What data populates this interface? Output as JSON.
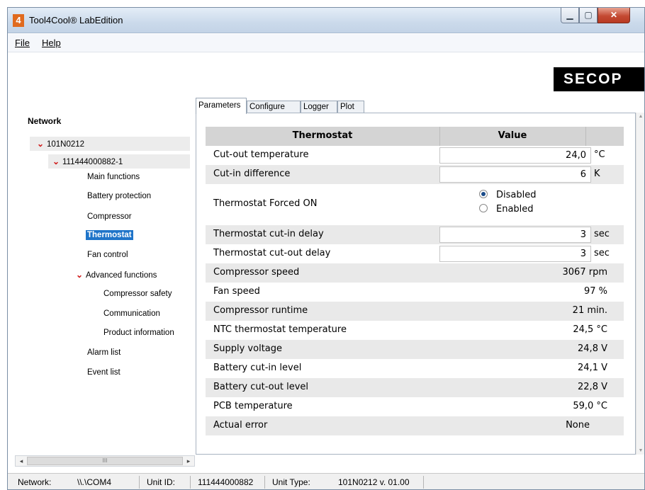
{
  "window": {
    "title": "Tool4Cool® LabEdition",
    "icon_glyph": "4"
  },
  "menu": {
    "file": "File",
    "help": "Help"
  },
  "logo": "SECOP",
  "tree": {
    "root_label": "Network",
    "items": [
      {
        "label": "101N0212",
        "expanded": true
      },
      {
        "label": "111444000882-1",
        "expanded": true
      },
      {
        "label": "Main functions"
      },
      {
        "label": "Battery protection"
      },
      {
        "label": "Compressor"
      },
      {
        "label": "Thermostat",
        "selected": true
      },
      {
        "label": "Fan control"
      },
      {
        "label": "Advanced functions",
        "expanded": true
      },
      {
        "label": "Compressor safety"
      },
      {
        "label": "Communication"
      },
      {
        "label": "Product information"
      },
      {
        "label": "Alarm list"
      },
      {
        "label": "Event list"
      }
    ]
  },
  "tabs": [
    "Parameters",
    "Configure",
    "Logger",
    "Plot"
  ],
  "active_tab": "Parameters",
  "table": {
    "col_name": "Thermostat",
    "col_value": "Value",
    "rows": [
      {
        "name": "Cut-out temperature",
        "value": "24,0",
        "unit": "°C"
      },
      {
        "name": "Cut-in difference",
        "value": "6",
        "unit": "K"
      },
      {
        "name": "Thermostat Forced ON",
        "options": [
          "Disabled",
          "Enabled"
        ],
        "selected": "Disabled"
      },
      {
        "name": "Thermostat cut-in delay",
        "value": "3",
        "unit": "sec"
      },
      {
        "name": "Thermostat cut-out delay",
        "value": "3",
        "unit": "sec"
      },
      {
        "name": "Compressor speed",
        "value": "3067 rpm"
      },
      {
        "name": "Fan speed",
        "value": "97 %"
      },
      {
        "name": "Compressor runtime",
        "value": "21  min."
      },
      {
        "name": "NTC thermostat temperature",
        "value": "24,5 °C"
      },
      {
        "name": "Supply voltage",
        "value": "24,8 V"
      },
      {
        "name": "Battery cut-in level",
        "value": "24,1 V"
      },
      {
        "name": "Battery cut-out level",
        "value": "22,8 V"
      },
      {
        "name": "PCB temperature",
        "value": "59,0 °C"
      },
      {
        "name": "Actual error",
        "value": "None"
      }
    ]
  },
  "status_bar": {
    "network_label": "Network:",
    "network_value": "\\\\.\\COM4",
    "unit_id_label": "Unit ID:",
    "unit_id_value": "111444000882",
    "unit_type_label": "Unit Type:",
    "unit_type_value": "101N0212 v. 01.00"
  }
}
